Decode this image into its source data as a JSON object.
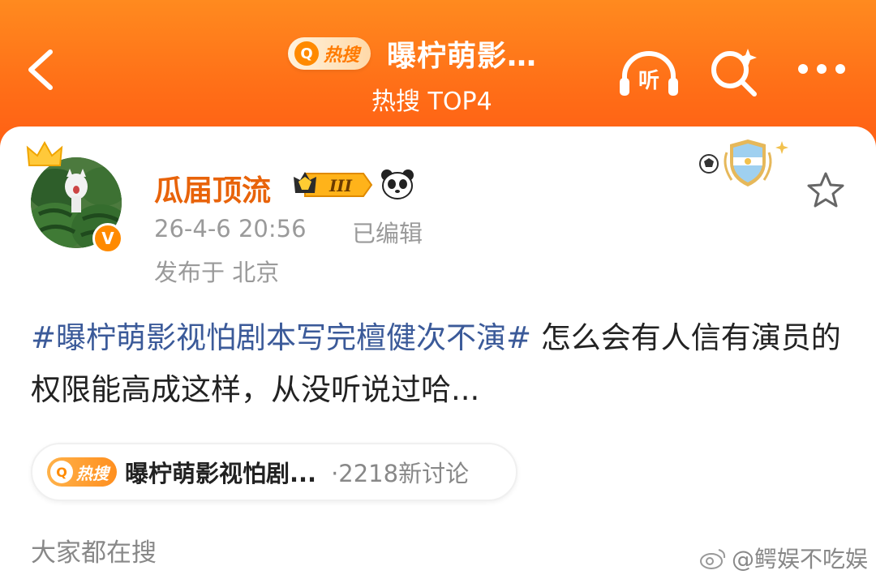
{
  "header": {
    "hot_badge_icon": "Q",
    "hot_badge_label": "热搜",
    "title": "曝柠萌影…",
    "subtitle": "热搜 TOP4",
    "listen_label": "听"
  },
  "post": {
    "username": "瓜届顶流",
    "level_label": "III",
    "verified_label": "V",
    "timestamp": "26-4-6 20:56",
    "edited": "已编辑",
    "location": "发布于 北京",
    "hashtag": "#曝柠萌影视怕剧本写完檀健次不演#",
    "body": " 怎么会有人信有演员的权限能高成这样，从没听说过哈..."
  },
  "topic": {
    "badge_icon": "Q",
    "badge_label": "热搜",
    "title": "曝柠萌影视怕剧...",
    "count": "·2218新讨论"
  },
  "section": {
    "label": "大家都在搜"
  },
  "watermark": {
    "text": "@鳄娱不吃娱"
  },
  "colors": {
    "header": "#ff6d17",
    "username": "#e8630a",
    "hashtag": "#3b5a99"
  }
}
